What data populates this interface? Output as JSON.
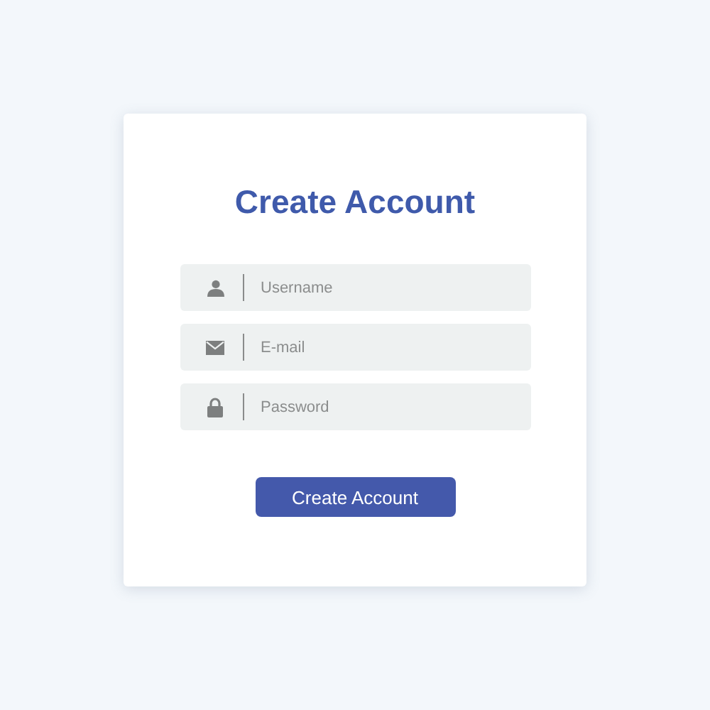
{
  "title": "Create Account",
  "fields": [
    {
      "kind": "user",
      "placeholder": "Username"
    },
    {
      "kind": "email",
      "placeholder": "E-mail"
    },
    {
      "kind": "lock",
      "placeholder": "Password"
    }
  ],
  "submit": "Create Account"
}
